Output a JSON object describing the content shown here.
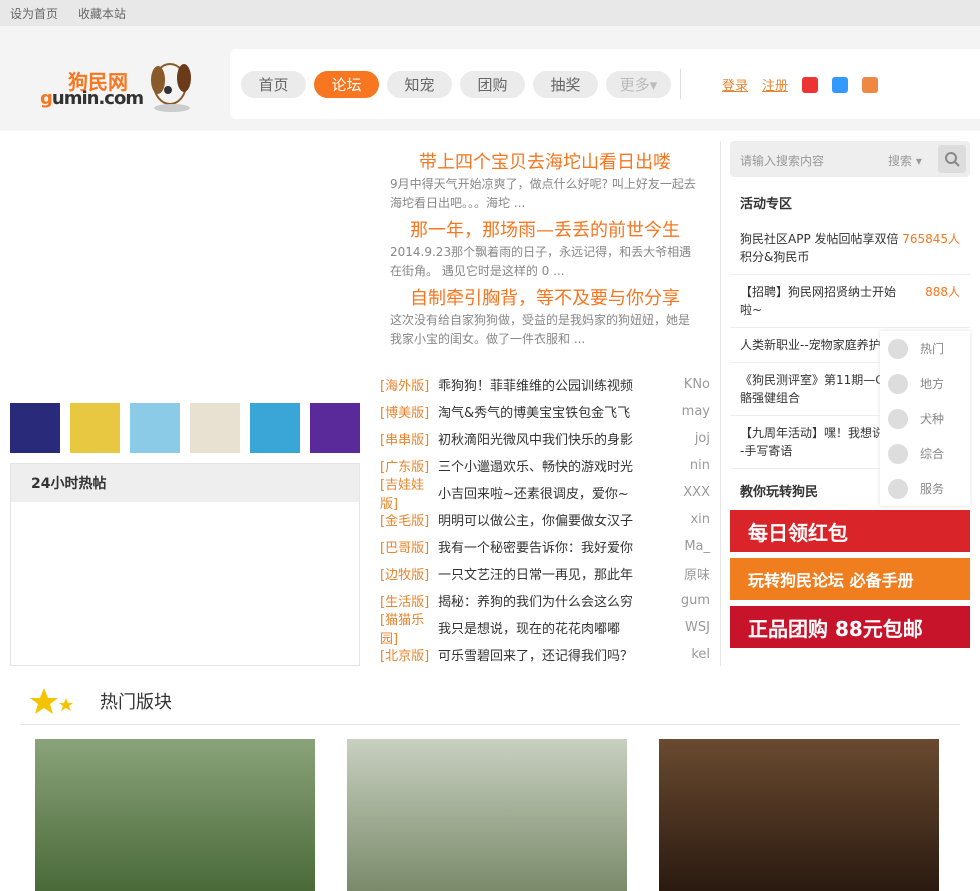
{
  "topbar": {
    "home": "设为首页",
    "fav": "收藏本站"
  },
  "logo": {
    "cn": "狗民网",
    "en1": "g",
    "en2": "umin.com"
  },
  "nav": [
    "首页",
    "论坛",
    "知宠",
    "团购",
    "抽奖",
    "更多"
  ],
  "login": {
    "login": "登录",
    "register": "注册"
  },
  "featured": [
    {
      "title": "带上四个宝贝去海坨山看日出喽",
      "desc": "9月中得天气开始凉爽了，做点什么好呢? 叫上好友一起去海坨看日出吧。。。海坨 ..."
    },
    {
      "title": "那一年，那场雨—丢丢的前世今生",
      "desc": "2014.9.23那个飘着雨的日子，永远记得，和丢大爷相遇在街角。 遇见它时是这样的 0 ..."
    },
    {
      "title": "自制牵引胸背，等不及要与你分享",
      "desc": "这次没有给自家狗狗做，受益的是我妈家的狗妞妞，她是我家小宝的闺女。做了一件衣服和 ..."
    }
  ],
  "posts": [
    {
      "forum": "[海外版]",
      "title": "乖狗狗！菲菲维维的公园训练视频",
      "author": "KNo"
    },
    {
      "forum": "[博美版]",
      "title": "淘气&秀气的博美宝宝铁包金飞飞",
      "author": "may"
    },
    {
      "forum": "[串串版]",
      "title": "初秋滴阳光微风中我们快乐的身影",
      "author": "joj"
    },
    {
      "forum": "[广东版]",
      "title": "三个小邋遢欢乐、畅快的游戏时光",
      "author": "nin"
    },
    {
      "forum": "[吉娃娃版]",
      "title": "小吉回来啦~还素很调皮，爱你~",
      "author": "XXX"
    },
    {
      "forum": "[金毛版]",
      "title": "明明可以做公主，你偏要做女汉子",
      "author": "xin"
    },
    {
      "forum": "[巴哥版]",
      "title": "我有一个秘密要告诉你：我好爱你",
      "author": "Ma_"
    },
    {
      "forum": "[边牧版]",
      "title": "一只文艺汪的日常一再见，那此年",
      "author": "原味"
    },
    {
      "forum": "[生活版]",
      "title": "揭秘：养狗的我们为什么会这么穷",
      "author": "gum"
    },
    {
      "forum": "[猫猫乐园]",
      "title": "我只是想说，现在的花花肉嘟嘟",
      "author": "WSJ"
    },
    {
      "forum": "[北京版]",
      "title": "可乐雪碧回来了，还记得我们吗？",
      "author": "kel"
    }
  ],
  "hot24": "24小时热帖",
  "search": {
    "placeholder": "请输入搜索内容",
    "select": "搜索"
  },
  "activity": {
    "title": "活动专区",
    "items": [
      {
        "text": "狗民社区APP 发帖回帖享双倍积分&狗民币",
        "num": "765845人"
      },
      {
        "text": "【招聘】狗民网招贤纳士开始啦~",
        "num": "888人"
      },
      {
        "text": "人类新职业--宠物家庭养护",
        "num": ""
      },
      {
        "text": "《狗民测评室》第11期—G骨骼强健组合",
        "num": ""
      },
      {
        "text": "【九周年活动】嘿！我想说----手写寄语",
        "num": ""
      }
    ]
  },
  "float": [
    "热门",
    "地方",
    "犬种",
    "综合",
    "服务"
  ],
  "teach": "教你玩转狗民",
  "banners": [
    "每日领红包",
    "玩转狗民论坛 必备手册",
    "正品团购 88元包邮"
  ],
  "hotsection": "热门版块"
}
